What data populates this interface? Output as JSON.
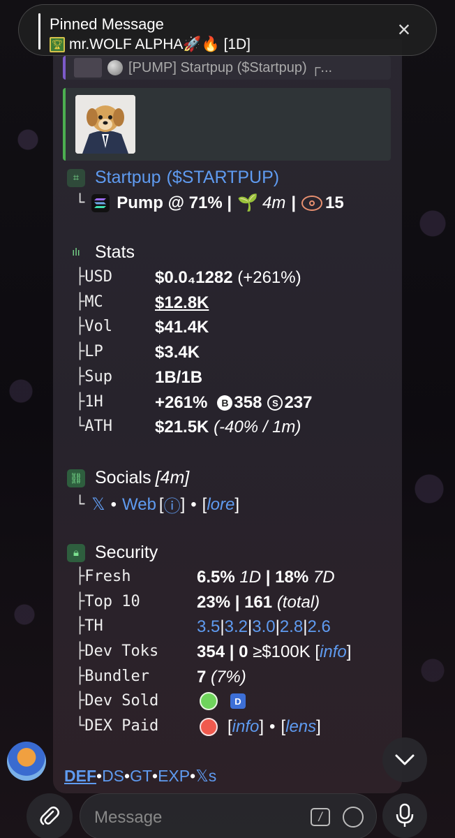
{
  "pinned": {
    "title": "Pinned Message",
    "subtitle": "mr.WOLF ALPHA🚀🔥 [1D]",
    "close_icon": "×"
  },
  "reply": {
    "text": "[PUMP] Startpup ($Startpup) ┌..."
  },
  "token": {
    "name": "Startpup",
    "ticker": "($STARTPUP)",
    "platform_line": "Pump @ 71% |",
    "age": "4m",
    "sep": "|",
    "views": "15"
  },
  "stats": {
    "title": "Stats",
    "rows": [
      {
        "branch": "├",
        "label": "USD",
        "value": "$0.0₄1282",
        "extra": "(+261%)"
      },
      {
        "branch": "├",
        "label": "MC",
        "value": "$12.8K"
      },
      {
        "branch": "├",
        "label": "Vol",
        "value": "$41.4K"
      },
      {
        "branch": "├",
        "label": "LP",
        "value": "$3.4K"
      },
      {
        "branch": "├",
        "label": "Sup",
        "value": "1B/1B"
      },
      {
        "branch": "├",
        "label": "1H",
        "value": "+261%",
        "buys": "358",
        "sells": "237"
      },
      {
        "branch": "└",
        "label": "ATH",
        "value": "$21.5K",
        "extra": "(-40% / 1m)"
      }
    ]
  },
  "socials": {
    "title": "Socials",
    "age": "[4m]",
    "x": "𝕏",
    "dot1": "•",
    "web": "Web",
    "info_bracket_open": "[",
    "info_icon": "ⓘ",
    "info_bracket_close": "]",
    "dot2": "•",
    "lore_open": "[",
    "lore": "lore",
    "lore_close": "]"
  },
  "security": {
    "title": "Security",
    "rows": {
      "fresh": {
        "branch": "├",
        "label": "Fresh",
        "v1": "6.5%",
        "v1u": "1D",
        "sep": "|",
        "v2": "18%",
        "v2u": "7D"
      },
      "top10": {
        "branch": "├",
        "label": "Top 10",
        "v1": "23% | 161",
        "v2": "(total)"
      },
      "th": {
        "branch": "├",
        "label": "TH",
        "values": [
          "3.5",
          "3.2",
          "3.0",
          "2.8",
          "2.6"
        ]
      },
      "devtoks": {
        "branch": "├",
        "label": "Dev Toks",
        "v1": "354 | 0",
        "v2": "≥$100K",
        "open": "[",
        "info": "info",
        "close": "]"
      },
      "bundler": {
        "branch": "├",
        "label": "Bundler",
        "v1": "7",
        "v2": "(7%)"
      },
      "devsold": {
        "branch": "├",
        "label": "Dev Sold",
        "badge": "D"
      },
      "dexpaid": {
        "branch": "└",
        "label": "DEX Paid",
        "info": "info",
        "lens": "lens",
        "dot": "•"
      }
    }
  },
  "footer_links": [
    "DEF",
    "DS",
    "GT",
    "EXP",
    "𝕏s"
  ],
  "footer_dot": "•",
  "input": {
    "placeholder": "Message",
    "cmd": "/"
  },
  "colors": {
    "accent_link": "#5f9bf0",
    "green_status": "#6fd45c",
    "red_status": "#f05a4e",
    "reply_border": "#7c5ac9",
    "media_border": "#4caf50"
  }
}
